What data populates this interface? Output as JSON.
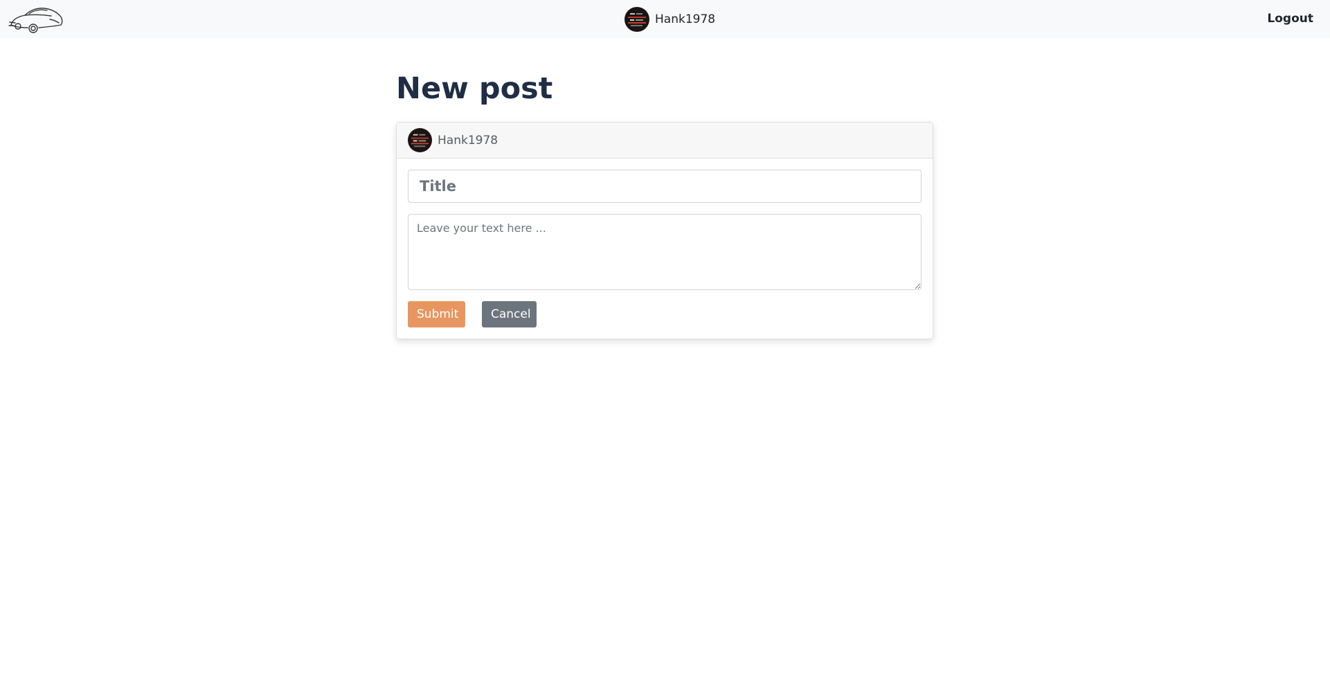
{
  "navbar": {
    "logo_icon": "car-logo-icon",
    "username": "Hank1978",
    "logout_label": "Logout"
  },
  "page": {
    "title": "New post"
  },
  "card": {
    "username": "Hank1978",
    "title_placeholder": "Title",
    "title_value": "",
    "text_placeholder": "Leave your text here ...",
    "text_value": "",
    "submit_label": "Submit",
    "cancel_label": "Cancel"
  },
  "colors": {
    "navbar_bg": "#f8f9fa",
    "heading": "#1f2d45",
    "submit": "#e8965f",
    "cancel": "#6c757d"
  }
}
